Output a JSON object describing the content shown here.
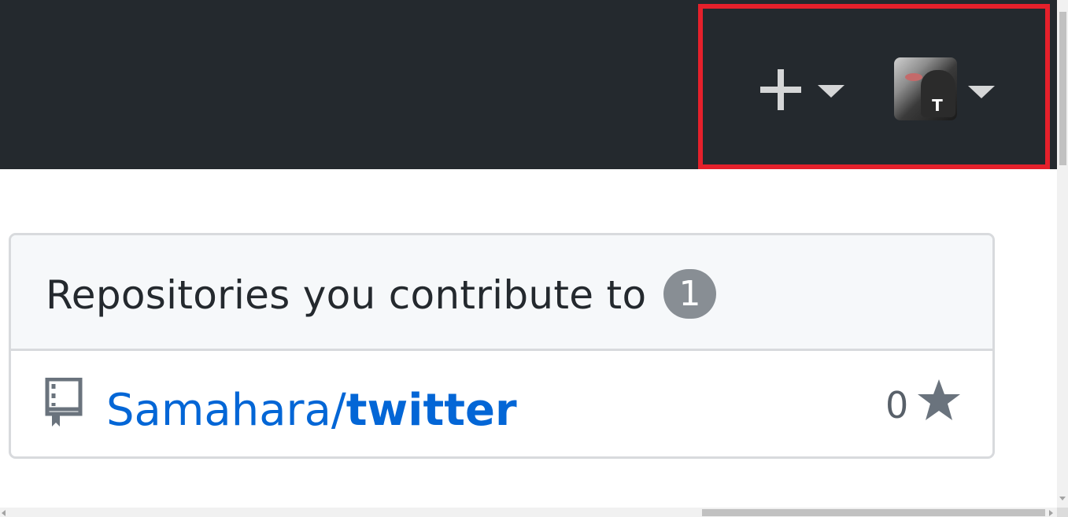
{
  "header": {
    "create_menu": {
      "icon": "plus-icon",
      "dropdown_icon": "caret-down-icon"
    },
    "user_menu": {
      "avatar_logo_text": "T",
      "dropdown_icon": "caret-down-icon"
    },
    "highlight_color": "#e5202b",
    "background_color": "#24292e"
  },
  "repositories_card": {
    "title": "Repositories you contribute to",
    "count": "1",
    "items": [
      {
        "icon": "repo-book-icon",
        "owner": "Samahara/",
        "name": "twitter",
        "stars": "0",
        "star_icon": "star-icon"
      }
    ]
  },
  "colors": {
    "link": "#0366d6",
    "text": "#24292e",
    "muted": "#586069",
    "badge": "#888e94"
  }
}
